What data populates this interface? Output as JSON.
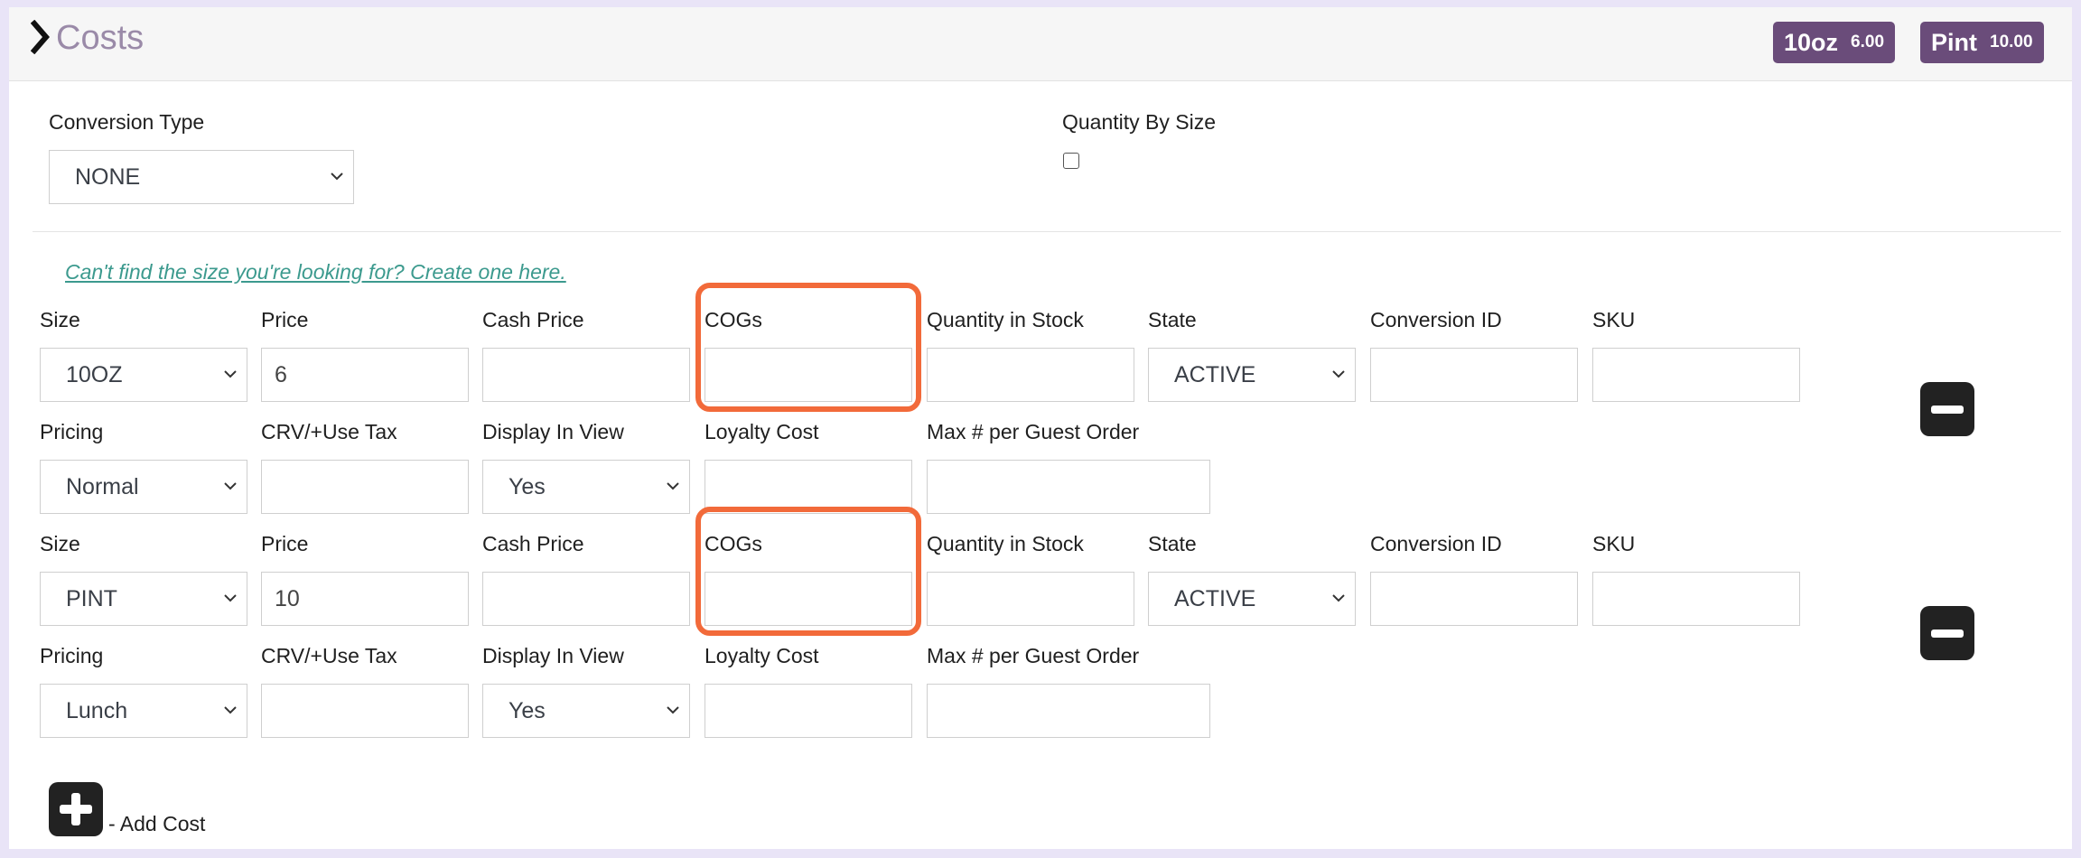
{
  "header": {
    "title": "Costs",
    "badges": [
      {
        "name": "10oz",
        "value": "6.00"
      },
      {
        "name": "Pint",
        "value": "10.00"
      }
    ]
  },
  "settings": {
    "conversion_type_label": "Conversion Type",
    "conversion_type_value": "NONE",
    "quantity_by_size_label": "Quantity By Size",
    "quantity_by_size_checked": false
  },
  "link_text": "Can't find the size you're looking for? Create one here.",
  "labels": {
    "size": "Size",
    "price": "Price",
    "cash_price": "Cash Price",
    "cogs": "COGs",
    "qty_stock": "Quantity in Stock",
    "state": "State",
    "conversion_id": "Conversion ID",
    "sku": "SKU",
    "pricing": "Pricing",
    "crv": "CRV/+Use Tax",
    "display": "Display In View",
    "loyalty": "Loyalty Cost",
    "max_guest": "Max # per Guest Order"
  },
  "costs": [
    {
      "size": "10OZ",
      "price": "6",
      "cash_price": "",
      "cogs": "",
      "qty_stock": "",
      "state": "ACTIVE",
      "conversion_id": "",
      "sku": "",
      "pricing": "Normal",
      "crv": "",
      "display": "Yes",
      "loyalty": "",
      "max_guest": ""
    },
    {
      "size": "PINT",
      "price": "10",
      "cash_price": "",
      "cogs": "",
      "qty_stock": "",
      "state": "ACTIVE",
      "conversion_id": "",
      "sku": "",
      "pricing": "Lunch",
      "crv": "",
      "display": "Yes",
      "loyalty": "",
      "max_guest": ""
    }
  ],
  "add_cost_label": "- Add Cost",
  "colors": {
    "badge": "#6a4c7a",
    "highlight": "#f26a3a",
    "link": "#3c9a8e",
    "title": "#9a8aa8"
  }
}
